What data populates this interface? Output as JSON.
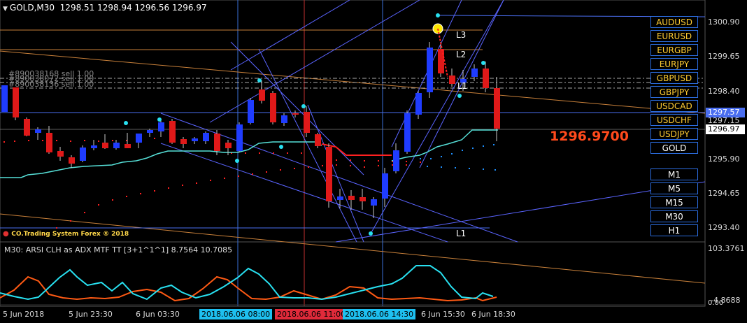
{
  "header": {
    "symbol_tf": "GOLD,M30",
    "ohlc": "1298.51 1298.94 1296.56 1296.97"
  },
  "orders": [
    "#890038168 sell 1.00",
    "#890038072 sell 1.00",
    "#890038136 sell 1.00"
  ],
  "watermark": "CO.Trading System Forex ® 2018",
  "line_labels": {
    "l3": "L3",
    "l2": "L2",
    "l1_top": "L1",
    "l1_bottom": "L1"
  },
  "current_price_text": "1296.9700",
  "symbol_buttons": [
    "AUDUSD",
    "EURUSD",
    "EURGBP",
    "EURJPY",
    "GBPUSD",
    "GBPJPY",
    "USDCAD",
    "USDCHF",
    "USDJPY",
    "GOLD"
  ],
  "timeframe_buttons": [
    "M1",
    "M5",
    "M15",
    "M30",
    "H1"
  ],
  "price_axis": {
    "ticks": [
      "1300.90",
      "1299.65",
      "1298.40",
      "1297.15",
      "1295.90",
      "1294.65",
      "1293.40"
    ],
    "bid_line_label": "1297.57",
    "current_label": "1296.97"
  },
  "indicator": {
    "title": "M30: ARSI CLH as ADX MTF TT [3+1^1^1] 8.7564 10.7085",
    "axis_max": "103.3761",
    "axis_min": "0.00",
    "axis_low": "-4.8688"
  },
  "time_axis": {
    "labels": [
      "5 Jun 2018",
      "5 Jun 23:30",
      "6 Jun 03:30",
      "6 Jun 15:30",
      "6 Jun 18:30"
    ],
    "highlighted": [
      "2018.06.06 08:00",
      "2018.06.06 11:00",
      "2018.06.06 14:30"
    ]
  },
  "colors": {
    "bull_candle": "#1f3cff",
    "bear_candle": "#e01919",
    "support_line": "#56e0d8",
    "dots_red": "#ff2020",
    "dots_blue": "#1e90ff",
    "osc_cyan": "#28e0f0",
    "osc_orange": "#ff5a14",
    "bid_line": "#4a6ef0",
    "highlight_cyan": "#1ec0f0",
    "highlight_red": "#e02a3a"
  }
}
